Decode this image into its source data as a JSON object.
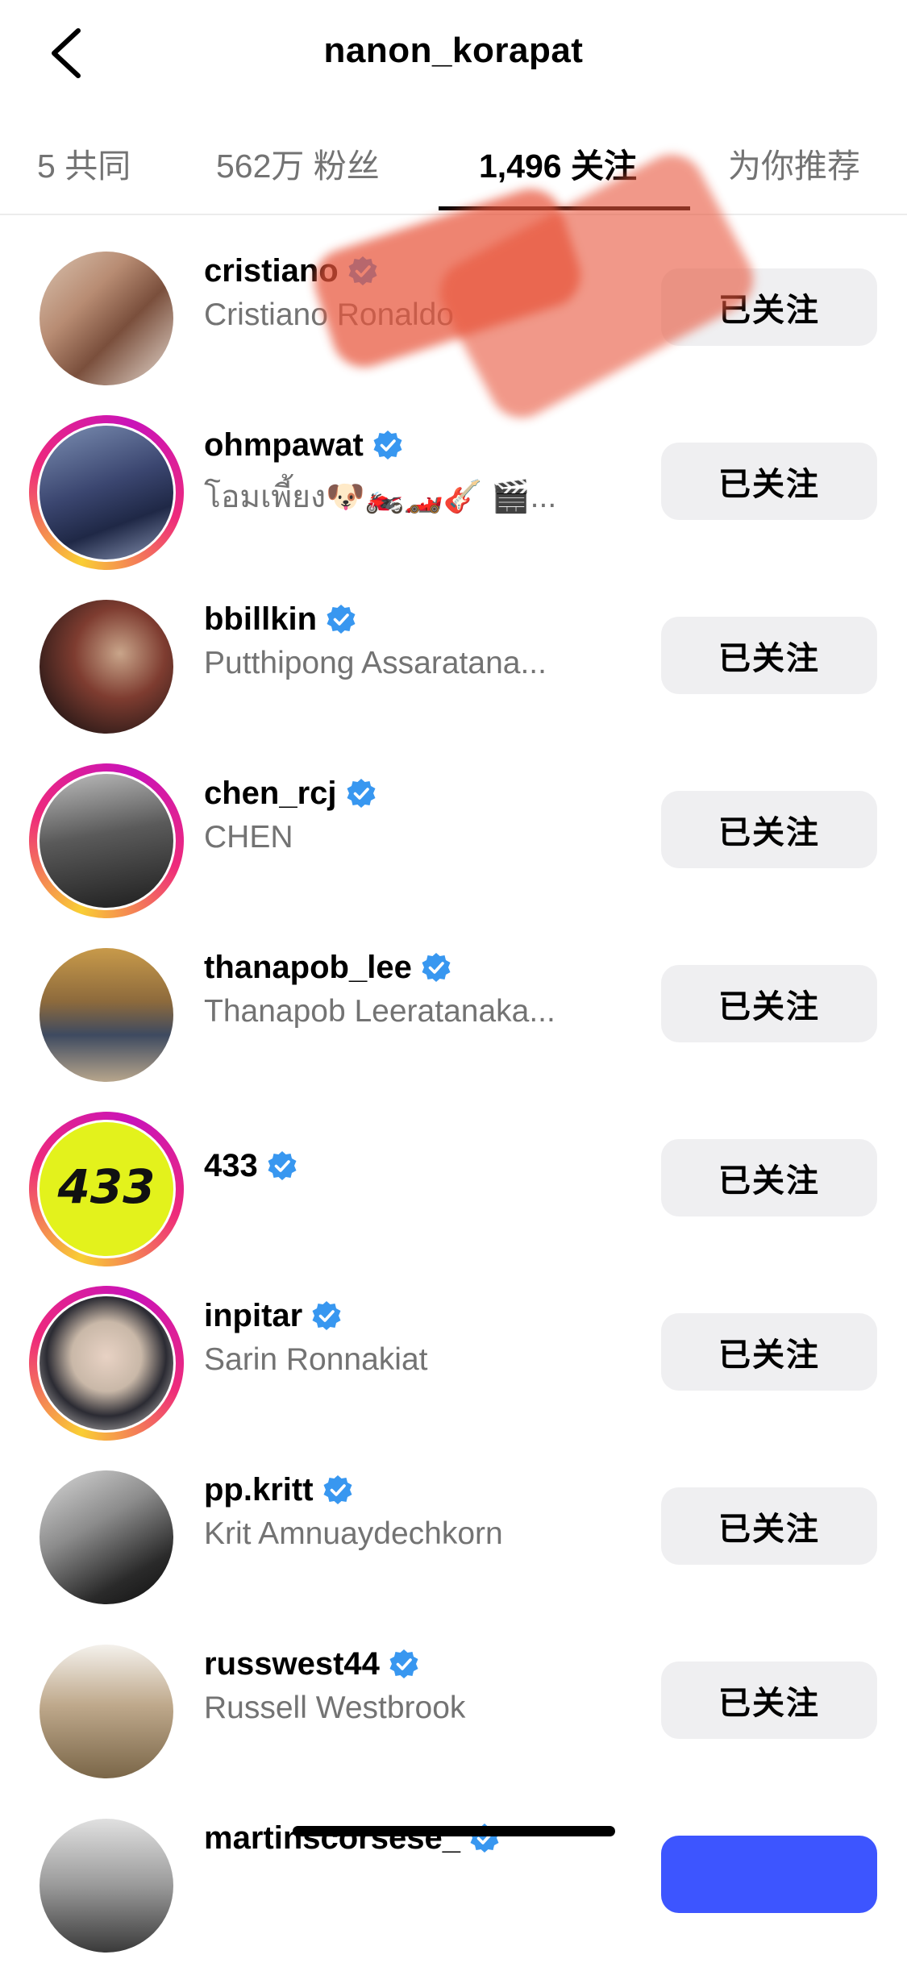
{
  "header": {
    "title": "nanon_korapat",
    "back_icon": "chevron-left-icon"
  },
  "tabs": [
    {
      "label": "5 共同",
      "active": false
    },
    {
      "label": "562万 粉丝",
      "active": false
    },
    {
      "label": "1,496 关注",
      "active": true
    },
    {
      "label": "为你推荐",
      "active": false
    }
  ],
  "accent_colors": {
    "verified": "#3897f0",
    "follow_primary": "#3d55ff",
    "following_bg": "#efeff1"
  },
  "users": [
    {
      "username": "cristiano",
      "fullname": "Cristiano Ronaldo",
      "verified": true,
      "story_ring": false,
      "button": "已关注"
    },
    {
      "username": "ohmpawat",
      "fullname": "โอมเพี้ยง🐶🏍️🏎️🎸 🎬...",
      "verified": true,
      "story_ring": true,
      "button": "已关注"
    },
    {
      "username": "bbillkin",
      "fullname": "Putthipong Assaratana...",
      "verified": true,
      "story_ring": false,
      "button": "已关注"
    },
    {
      "username": "chen_rcj",
      "fullname": "CHEN",
      "verified": true,
      "story_ring": true,
      "button": "已关注"
    },
    {
      "username": "thanapob_lee",
      "fullname": "Thanapob Leeratanaka...",
      "verified": true,
      "story_ring": false,
      "button": "已关注"
    },
    {
      "username": "433",
      "fullname": "",
      "verified": true,
      "story_ring": true,
      "button": "已关注"
    },
    {
      "username": "inpitar",
      "fullname": "Sarin Ronnakiat",
      "verified": true,
      "story_ring": true,
      "button": "已关注"
    },
    {
      "username": "pp.kritt",
      "fullname": "Krit Amnuaydechkorn",
      "verified": true,
      "story_ring": false,
      "button": "已关注"
    },
    {
      "username": "russwest44",
      "fullname": "Russell Westbrook",
      "verified": true,
      "story_ring": false,
      "button": "已关注"
    },
    {
      "username": "martinscorsese_",
      "fullname": "",
      "verified": true,
      "story_ring": false,
      "button": ""
    }
  ]
}
